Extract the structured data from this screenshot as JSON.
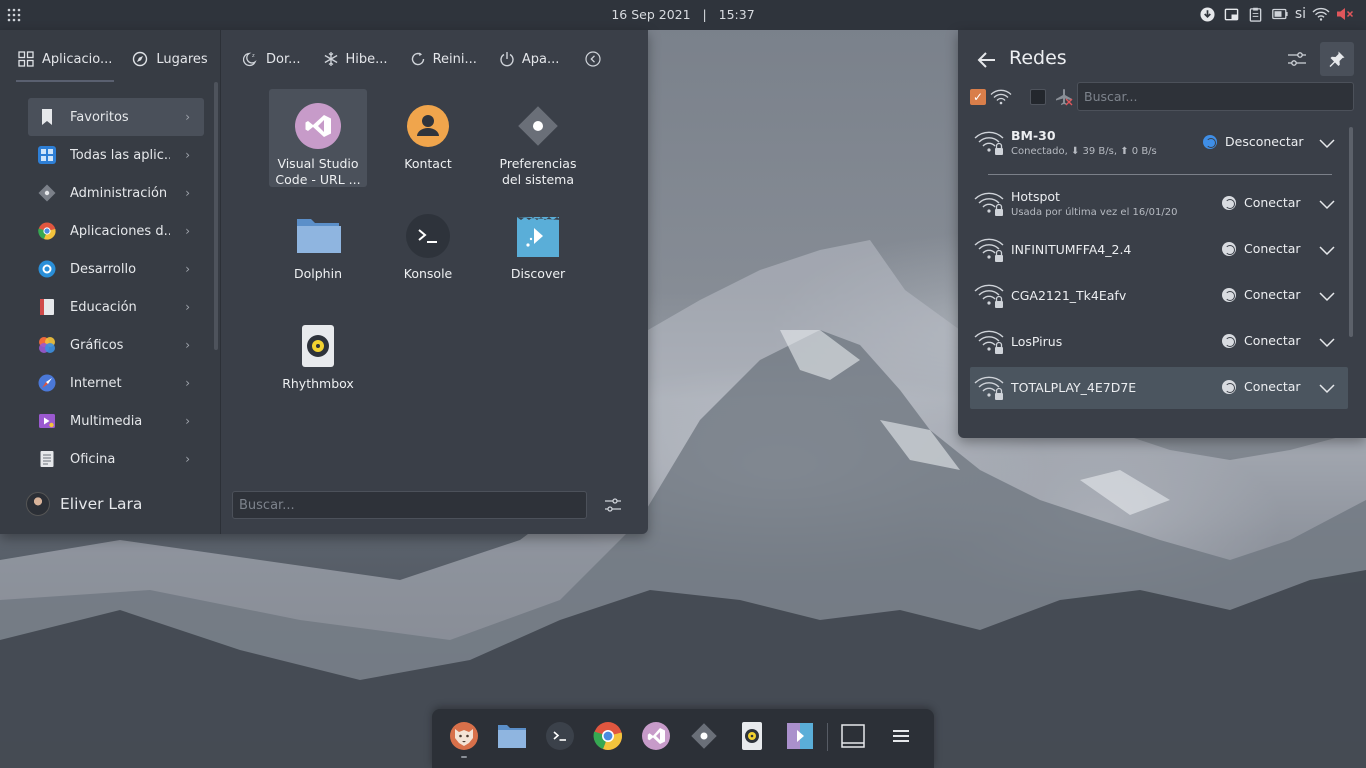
{
  "top_panel": {
    "date": "16 Sep 2021",
    "time": "15:37",
    "clock_separator": "|",
    "keyboard_layout": "si",
    "tray_icons": [
      "download-icon",
      "screenshot-icon",
      "clipboard-icon",
      "battery-icon",
      "keyboard-layout",
      "wifi-icon",
      "volume-muted-icon"
    ]
  },
  "launcher": {
    "tabs": [
      {
        "label": "Aplicacio...",
        "icon": "apps-grid-icon"
      },
      {
        "label": "Lugares",
        "icon": "compass-icon"
      }
    ],
    "power": [
      {
        "label": "Dor...",
        "icon": "sleep-icon"
      },
      {
        "label": "Hibe...",
        "icon": "hibernate-icon"
      },
      {
        "label": "Reini...",
        "icon": "restart-icon"
      },
      {
        "label": "Apa...",
        "icon": "shutdown-icon"
      }
    ],
    "categories": [
      {
        "label": "Favoritos",
        "icon": "bookmark-icon",
        "color": "#e6e8eb"
      },
      {
        "label": "Todas las aplic...",
        "icon": "all-apps-icon",
        "color": "#3d8fe0"
      },
      {
        "label": "Administración",
        "icon": "admin-icon",
        "color": "#8a8f97"
      },
      {
        "label": "Aplicaciones d...",
        "icon": "chrome-icon",
        "color": "#e0563f"
      },
      {
        "label": "Desarrollo",
        "icon": "development-icon",
        "color": "#2a8fd8"
      },
      {
        "label": "Educación",
        "icon": "education-icon",
        "color": "#e0e2e6"
      },
      {
        "label": "Gráficos",
        "icon": "graphics-icon",
        "color": "#f0a030"
      },
      {
        "label": "Internet",
        "icon": "internet-icon",
        "color": "#4a78d8"
      },
      {
        "label": "Multimedia",
        "icon": "multimedia-icon",
        "color": "#9b59d0"
      },
      {
        "label": "Oficina",
        "icon": "office-icon",
        "color": "#d8dbe0"
      }
    ],
    "user_name": "Eliver Lara",
    "apps": [
      {
        "label": "Visual Studio Code - URL ...",
        "icon": "vscode-icon"
      },
      {
        "label": "Kontact",
        "icon": "kontact-icon"
      },
      {
        "label": "Preferencias del sistema",
        "icon": "system-settings-icon"
      },
      {
        "label": "Dolphin",
        "icon": "folder-icon"
      },
      {
        "label": "Konsole",
        "icon": "terminal-icon"
      },
      {
        "label": "Discover",
        "icon": "discover-icon"
      },
      {
        "label": "Rhythmbox",
        "icon": "rhythmbox-icon"
      }
    ],
    "search_placeholder": "Buscar..."
  },
  "network": {
    "title": "Redes",
    "wifi_enabled": true,
    "airplane_mode": false,
    "search_placeholder": "Buscar...",
    "connections": [
      {
        "name": "BM-30",
        "status": "Conectado, ⬇ 39 B/s, ⬆ 0 B/s",
        "action": "Desconectar",
        "connected": true
      },
      {
        "name": "Hotspot",
        "status": "Usada por última vez el 16/01/20",
        "action": "Conectar",
        "connected": false
      },
      {
        "name": "INFINITUMFFA4_2.4",
        "status": "",
        "action": "Conectar",
        "connected": false
      },
      {
        "name": "CGA2121_Tk4Eafv",
        "status": "",
        "action": "Conectar",
        "connected": false
      },
      {
        "name": "LosPirus",
        "status": "",
        "action": "Conectar",
        "connected": false
      },
      {
        "name": "TOTALPLAY_4E7D7E",
        "status": "",
        "action": "Conectar",
        "connected": false
      }
    ]
  },
  "dock": {
    "items": [
      "firefox-icon",
      "files-icon",
      "terminal-icon",
      "chrome-icon",
      "vscode-icon",
      "system-settings-icon",
      "rhythmbox-icon",
      "discover-icon",
      "show-desktop-icon",
      "menu-icon"
    ]
  }
}
